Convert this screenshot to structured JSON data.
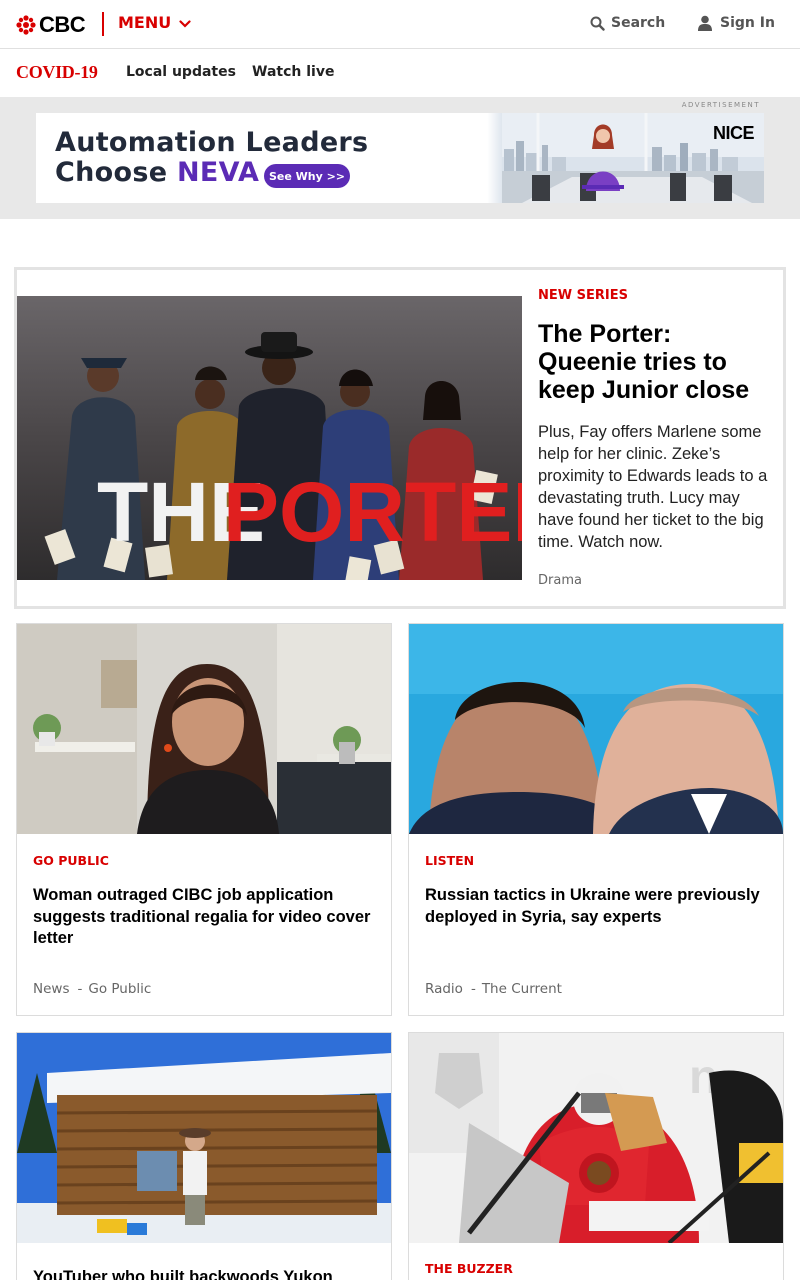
{
  "header": {
    "logo_text": "CBC",
    "menu_label": "MENU",
    "search_label": "Search",
    "signin_label": "Sign In"
  },
  "subnav": {
    "covid_label": "COVID-19",
    "links": [
      "Local updates",
      "Watch live"
    ]
  },
  "ad": {
    "label": "ADVERTISEMENT",
    "line1": "Automation Leaders",
    "line2_prefix": "Choose ",
    "line2_brand": "NEVA",
    "cta": "See Why >>",
    "brand_logo": "NICE",
    "accent": "#5b2bb5"
  },
  "feature": {
    "kicker": "NEW SERIES",
    "title": "The Porter: Queenie tries to keep Junior close",
    "description": "Plus, Fay offers Marlene some help for her clinic. Zeke’s proximity to Edwards leads to a devastating truth. Lucy may have found her ticket to the big time. Watch now.",
    "tag": "Drama",
    "image_text_1": "THE",
    "image_text_2": "PORTER"
  },
  "cards": [
    {
      "kicker": "GO PUBLIC",
      "title": "Woman outraged CIBC job application suggests traditional regalia for video cover letter",
      "meta_1": "News",
      "meta_2": "Go Public"
    },
    {
      "kicker": "LISTEN",
      "title": "Russian tactics in Ukraine were previously deployed in Syria, say experts",
      "meta_1": "Radio",
      "meta_2": "The Current"
    },
    {
      "kicker": "",
      "title": "YouTuber who built backwoods Yukon"
    },
    {
      "kicker": "THE BUZZER",
      "title": ""
    }
  ],
  "colors": {
    "brand_red": "#d80000",
    "meta_gray": "#666666"
  }
}
